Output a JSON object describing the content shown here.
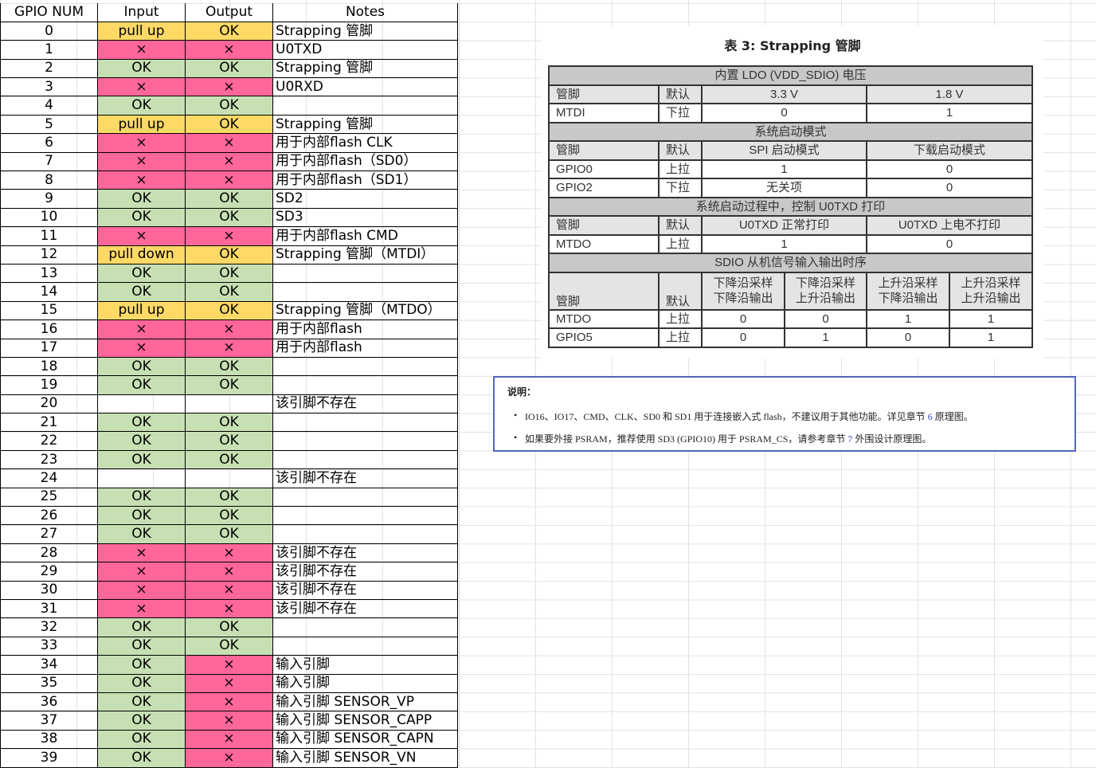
{
  "gpio_table": {
    "headers": [
      "GPIO NUM",
      "Input",
      "Output",
      "Notes"
    ],
    "rows": [
      [
        "0",
        "pull up",
        "OK",
        "Strapping 管脚"
      ],
      [
        "1",
        "×",
        "×",
        "U0TXD"
      ],
      [
        "2",
        "OK",
        "OK",
        "Strapping 管脚"
      ],
      [
        "3",
        "×",
        "×",
        "U0RXD"
      ],
      [
        "4",
        "OK",
        "OK",
        ""
      ],
      [
        "5",
        "pull up",
        "OK",
        "Strapping 管脚"
      ],
      [
        "6",
        "×",
        "×",
        "用于内部flash CLK"
      ],
      [
        "7",
        "×",
        "×",
        "用于内部flash（SD0）"
      ],
      [
        "8",
        "×",
        "×",
        "用于内部flash（SD1）"
      ],
      [
        "9",
        "OK",
        "OK",
        "SD2"
      ],
      [
        "10",
        "OK",
        "OK",
        "SD3"
      ],
      [
        "11",
        "×",
        "×",
        "用于内部flash CMD"
      ],
      [
        "12",
        "pull down",
        "OK",
        "Strapping 管脚（MTDI）"
      ],
      [
        "13",
        "OK",
        "OK",
        ""
      ],
      [
        "14",
        "OK",
        "OK",
        ""
      ],
      [
        "15",
        "pull up",
        "OK",
        "Strapping 管脚（MTDO）"
      ],
      [
        "16",
        "×",
        "×",
        "用于内部flash"
      ],
      [
        "17",
        "×",
        "×",
        "用于内部flash"
      ],
      [
        "18",
        "OK",
        "OK",
        ""
      ],
      [
        "19",
        "OK",
        "OK",
        ""
      ],
      [
        "20",
        "",
        "",
        "该引脚不存在"
      ],
      [
        "21",
        "OK",
        "OK",
        ""
      ],
      [
        "22",
        "OK",
        "OK",
        ""
      ],
      [
        "23",
        "OK",
        "OK",
        ""
      ],
      [
        "24",
        "",
        "",
        "该引脚不存在"
      ],
      [
        "25",
        "OK",
        "OK",
        ""
      ],
      [
        "26",
        "OK",
        "OK",
        ""
      ],
      [
        "27",
        "OK",
        "OK",
        ""
      ],
      [
        "28",
        "×",
        "×",
        "该引脚不存在"
      ],
      [
        "29",
        "×",
        "×",
        "该引脚不存在"
      ],
      [
        "30",
        "×",
        "×",
        "该引脚不存在"
      ],
      [
        "31",
        "×",
        "×",
        "该引脚不存在"
      ],
      [
        "32",
        "OK",
        "OK",
        ""
      ],
      [
        "33",
        "OK",
        "OK",
        ""
      ],
      [
        "34",
        "OK",
        "×",
        "输入引脚"
      ],
      [
        "35",
        "OK",
        "×",
        "输入引脚"
      ],
      [
        "36",
        "OK",
        "×",
        "输入引脚 SENSOR_VP"
      ],
      [
        "37",
        "OK",
        "×",
        "输入引脚 SENSOR_CAPP"
      ],
      [
        "38",
        "OK",
        "×",
        "输入引脚 SENSOR_CAPN"
      ],
      [
        "39",
        "OK",
        "×",
        "输入引脚 SENSOR_VN"
      ]
    ]
  },
  "colors": {
    "strap": "#FFD966",
    "bad": "#FF6699",
    "ok": "#C6E0B4"
  },
  "strapping": {
    "title": "表 3: Strapping 管脚",
    "sections": [
      {
        "title": "内置 LDO (VDD_SDIO) 电压",
        "cols": [
          "管脚",
          "默认",
          "3.3 V",
          "1.8 V"
        ],
        "rows": [
          [
            "MTDI",
            "下拉",
            "0",
            "1"
          ]
        ]
      },
      {
        "title": "系统启动模式",
        "cols": [
          "管脚",
          "默认",
          "SPI 启动模式",
          "下载启动模式"
        ],
        "rows": [
          [
            "GPIO0",
            "上拉",
            "1",
            "0"
          ],
          [
            "GPIO2",
            "下拉",
            "无关项",
            "0"
          ]
        ]
      },
      {
        "title": "系统启动过程中，控制 U0TXD 打印",
        "cols": [
          "管脚",
          "默认",
          "U0TXD 正常打印",
          "U0TXD 上电不打印"
        ],
        "rows": [
          [
            "MTDO",
            "上拉",
            "1",
            "0"
          ]
        ]
      },
      {
        "title": "SDIO 从机信号输入输出时序",
        "cols": [
          "管脚",
          "默认",
          "下降沿采样\n下降沿输出",
          "下降沿采样\n上升沿输出",
          "上升沿采样\n下降沿输出",
          "上升沿采样\n上升沿输出"
        ],
        "rows": [
          [
            "MTDO",
            "上拉",
            "0",
            "0",
            "1",
            "1"
          ],
          [
            "GPIO5",
            "上拉",
            "0",
            "1",
            "0",
            "1"
          ]
        ]
      }
    ]
  },
  "note": {
    "heading": "说明：",
    "items": [
      {
        "pre": "IO16、IO17、CMD、CLK、SD0 和 SD1 用于连接嵌入式 flash，不建议用于其他功能。详见章节 ",
        "link": "6",
        "post": " 原理图。"
      },
      {
        "pre": "如果要外接 PSRAM，推荐使用 SD3 (GPIO10) 用于 PSRAM_CS，请参考章节 ",
        "link": "7",
        "post": " 外围设计原理图。"
      }
    ]
  }
}
